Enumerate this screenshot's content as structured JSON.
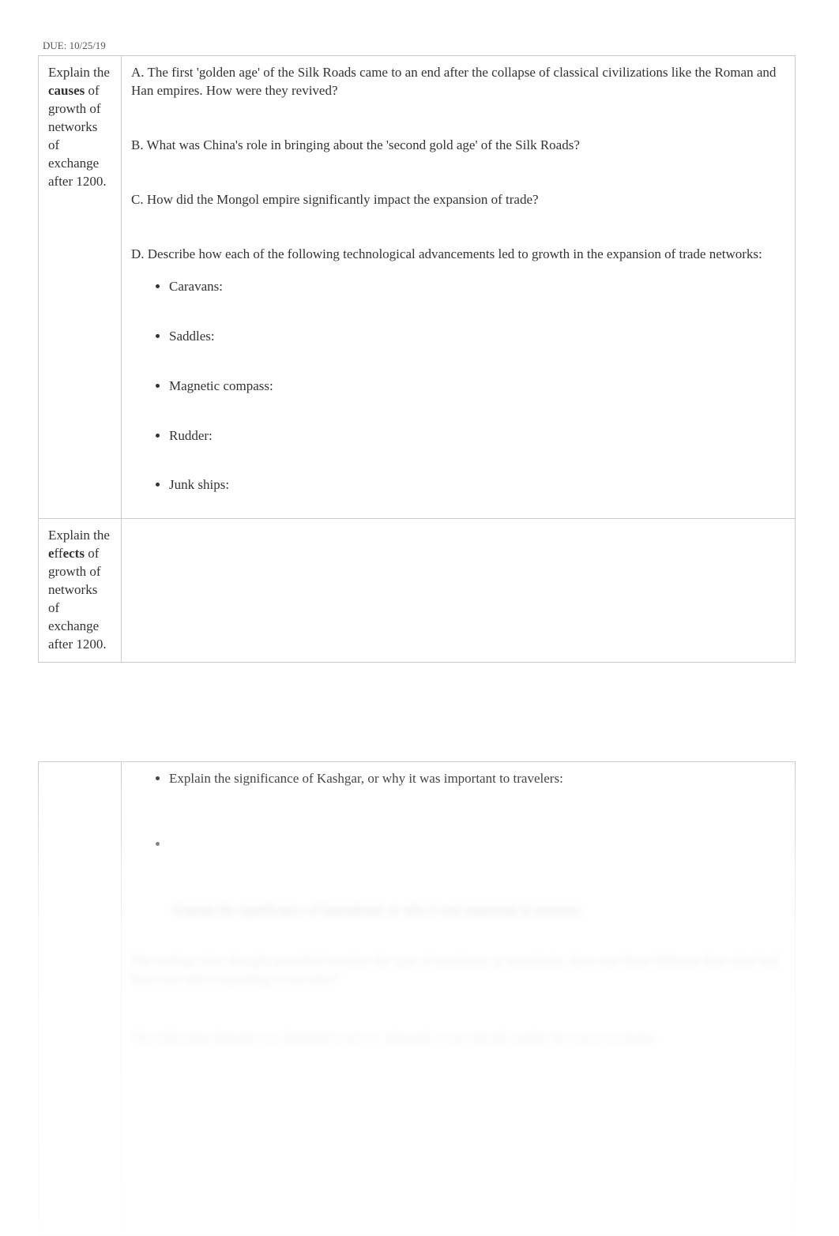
{
  "due": "DUE: 10/25/19",
  "left1_pre": "Explain the",
  "left1_bold": "causes",
  "left1_post": " of growth of networks of exchange after 1200.",
  "qA": "A. The first 'golden age' of the Silk Roads came to an end after the collapse of classical civilizations like the Roman and Han empires. How were they revived?",
  "qB": "B. What was China's role in bringing about the 'second gold age' of the Silk Roads?",
  "qC": "C. How did the Mongol empire significantly impact the expansion of trade?",
  "qD": "D. Describe how each of the following technological advancements led to growth in the expansion of trade networks:",
  "tech": [
    "Caravans:",
    "Saddles:",
    "Magnetic compass:",
    "Rudder:",
    "Junk ships:"
  ],
  "left2_pre": "Explain the",
  "left2_bold1": "e",
  "left2_mid": "ff",
  "left2_bold2": "ects",
  "left2_post": " of growth of networks of exchange after 1200.",
  "lower_bullet1": "Explain the significance of Kashgar, or why it was important to travelers:",
  "lower_bullet2": "",
  "blurred_indent": "Explain the significance of Samarkand, or why it was important to travelers:",
  "blurred_para1": "The trading cities thought provided travelers the type of merchants as merchants. How was these different than what had been here after expanding to travelers?",
  "blurred_para2": "The following diagram was designed to prove, although it was already usable the towns economy."
}
